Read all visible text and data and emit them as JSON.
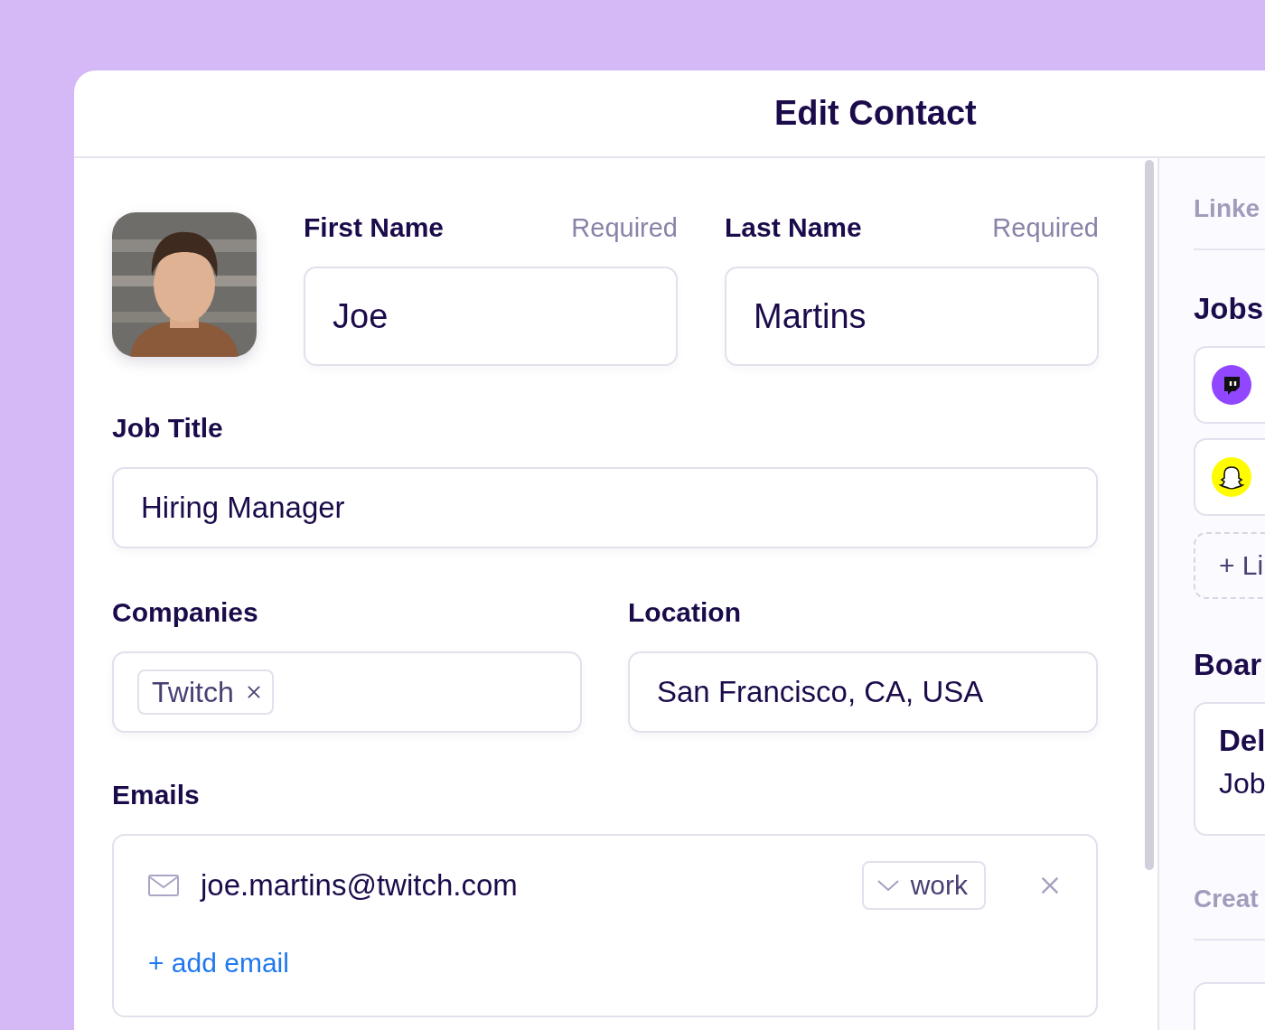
{
  "window": {
    "title": "Edit Contact"
  },
  "form": {
    "first_name": {
      "label": "First Name",
      "hint": "Required",
      "value": "Joe"
    },
    "last_name": {
      "label": "Last Name",
      "hint": "Required",
      "value": "Martins"
    },
    "job_title": {
      "label": "Job Title",
      "value": "Hiring Manager"
    },
    "companies": {
      "label": "Companies",
      "tags": [
        {
          "name": "Twitch"
        }
      ]
    },
    "location": {
      "label": "Location",
      "value": "San Francisco, CA, USA"
    },
    "emails": {
      "label": "Emails",
      "items": [
        {
          "address": "joe.martins@twitch.com",
          "type": "work"
        }
      ],
      "add_label": "+ add email"
    }
  },
  "sidebar": {
    "linked_heading": "Linke",
    "jobs": {
      "heading": "Jobs",
      "items": [
        {
          "kind": "chat"
        },
        {
          "kind": "ghost"
        }
      ],
      "add_label": "+ Li"
    },
    "boards": {
      "heading": "Boar",
      "cards": [
        {
          "title": "Del",
          "subtitle": "Job"
        }
      ]
    },
    "created_heading": "Creat"
  }
}
